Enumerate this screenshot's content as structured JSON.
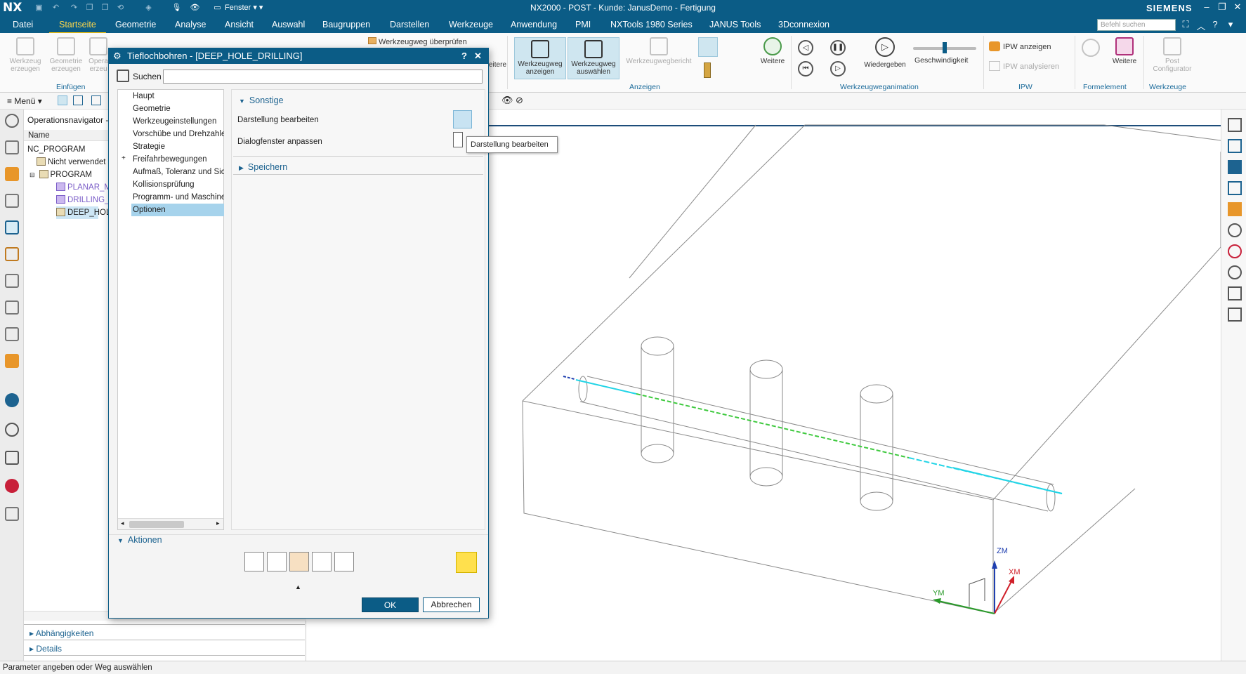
{
  "titlebar": {
    "logo": "NX",
    "fenster": "Fenster",
    "title": "NX2000 - POST - Kunde: JanusDemo - Fertigung",
    "brand": "SIEMENS"
  },
  "menubar": {
    "tabs": [
      "Datei",
      "Startseite",
      "Geometrie",
      "Analyse",
      "Ansicht",
      "Auswahl",
      "Baugruppen",
      "Darstellen",
      "Werkzeuge",
      "Anwendung",
      "PMI",
      "NXTools 1980 Series",
      "JANUS Tools",
      "3Dconnexion"
    ],
    "active_tab": "Startseite",
    "search_placeholder": "Befehl suchen"
  },
  "ribbon": {
    "einfuegen": {
      "label": "Einfügen",
      "btn1": "Werkzeug erzeugen",
      "btn2": "Geometrie erzeugen",
      "btn3": "Opera erzeu"
    },
    "werkzeugweg_ueberpruefen": "Werkzeugweg überprüfen",
    "weitere_cut": "eitere",
    "anzeigen": {
      "label": "Anzeigen",
      "btn1": "Werkzeugweg anzeigen",
      "btn2": "Werkzeugweg auswählen",
      "btn3": "Werkzeugwegbericht",
      "weitere": "Weitere"
    },
    "animation": {
      "label": "Werkzeugweganimation",
      "play": "Wiedergeben",
      "speed": "Geschwindigkeit",
      "speed_level": 0.5
    },
    "ipw": {
      "label": "IPW",
      "show": "IPW anzeigen",
      "analyze": "IPW analysieren"
    },
    "formelement": {
      "label": "Formelement",
      "weitere": "Weitere"
    },
    "werkzeuge": {
      "label": "Werkzeuge",
      "post": "Post Configurator"
    }
  },
  "subtoolbar": {
    "menu": "Menü"
  },
  "navigator": {
    "title": "Operationsnavigator - P",
    "column": "Name",
    "rows": [
      "NC_PROGRAM",
      "Nicht verwendet",
      "PROGRAM",
      "PLANAR_M",
      "DRILLING_",
      "DEEP_HOL"
    ],
    "accordions": [
      "Abhängigkeiten",
      "Details"
    ]
  },
  "dialog": {
    "title": "Tieflochbohren - [DEEP_HOLE_DRILLING]",
    "search_label": "Suchen",
    "search_value": "",
    "tree": [
      "Haupt",
      "Geometrie",
      "Werkzeugeinstellungen",
      "Vorschübe und Drehzahlen",
      "Strategie",
      "Freifahrbewegungen",
      "Aufmaß, Toleranz und Sich",
      "Kollisionsprüfung",
      "Programm- und Maschine",
      "Optionen"
    ],
    "selected": "Optionen",
    "sections": {
      "sonstige": "Sonstige",
      "speichern": "Speichern"
    },
    "options": {
      "darstellung": "Darstellung bearbeiten",
      "dialogfenster": "Dialogfenster anpassen"
    },
    "tooltip": "Darstellung bearbeiten",
    "aktionen": "Aktionen",
    "ok": "OK",
    "cancel": "Abbrechen"
  },
  "viewport": {
    "axes": {
      "z": "ZM",
      "x": "XM",
      "y": "YM"
    },
    "colors": {
      "toolpath_cyan": "#22d4e6",
      "toolpath_green": "#3ec93e",
      "axis_z": "#1f3fb0",
      "axis_x": "#d0202a",
      "axis_y": "#2a9a2a"
    }
  },
  "status": "Parameter angeben oder Weg auswählen"
}
